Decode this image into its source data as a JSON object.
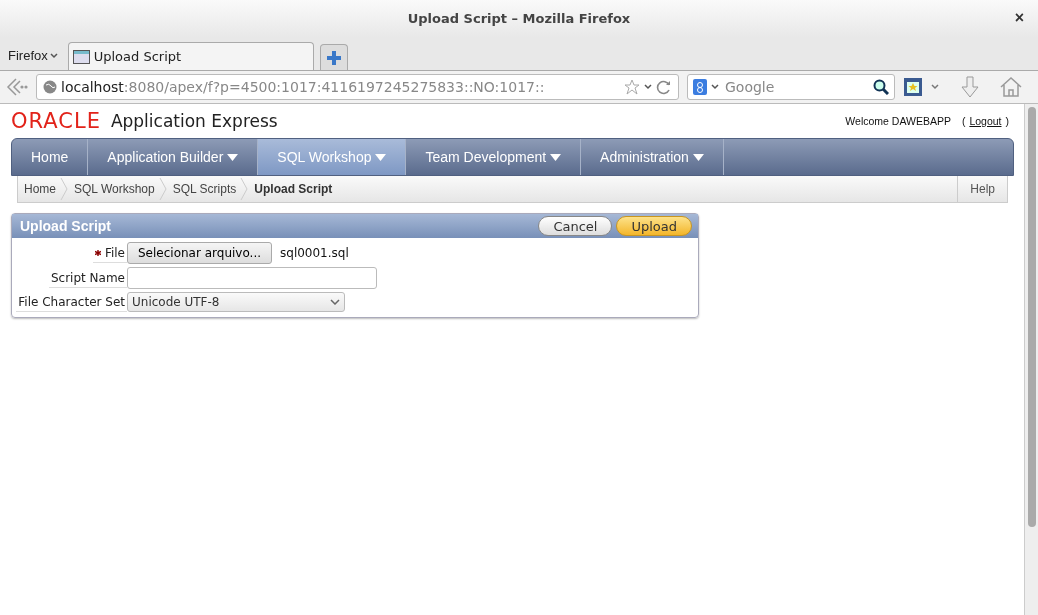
{
  "window": {
    "title": "Upload Script – Mozilla Firefox",
    "close": "×"
  },
  "browser": {
    "menu": "Firefox",
    "tabs": [
      {
        "label": "Upload Script",
        "selected": true
      }
    ],
    "address": {
      "host": "localhost",
      "path": ":8080/apex/f?p=4500:1017:4116197245275833::NO:1017::"
    },
    "search": {
      "placeholder": "Google"
    }
  },
  "app": {
    "logo": "ORACLE",
    "product": "Application Express",
    "welcome": "Welcome DAWEBAPP",
    "logout_open": "(",
    "logout": "Logout",
    "logout_close": ")",
    "nav": [
      {
        "label": "Home",
        "selected": false,
        "menu": false
      },
      {
        "label": "Application Builder",
        "selected": false,
        "menu": true
      },
      {
        "label": "SQL Workshop",
        "selected": true,
        "menu": true
      },
      {
        "label": "Team Development",
        "selected": false,
        "menu": true
      },
      {
        "label": "Administration",
        "selected": false,
        "menu": true
      }
    ],
    "breadcrumbs": [
      {
        "label": "Home",
        "selected": false
      },
      {
        "label": "SQL Workshop",
        "selected": false
      },
      {
        "label": "SQL Scripts",
        "selected": false
      },
      {
        "label": "Upload Script",
        "selected": true
      }
    ],
    "help": "Help",
    "region": {
      "title": "Upload Script",
      "buttons": [
        {
          "label": "Cancel",
          "kind": "plain"
        },
        {
          "label": "Upload",
          "kind": "primary"
        }
      ],
      "fields": [
        {
          "label": "File",
          "required": true,
          "kind": "file",
          "button": "Selecionar arquivo...",
          "value": "sql0001.sql"
        },
        {
          "label": "Script Name",
          "required": false,
          "kind": "text"
        },
        {
          "label": "File Character Set",
          "required": false,
          "kind": "select",
          "value": "Unicode UTF-8"
        }
      ]
    }
  }
}
